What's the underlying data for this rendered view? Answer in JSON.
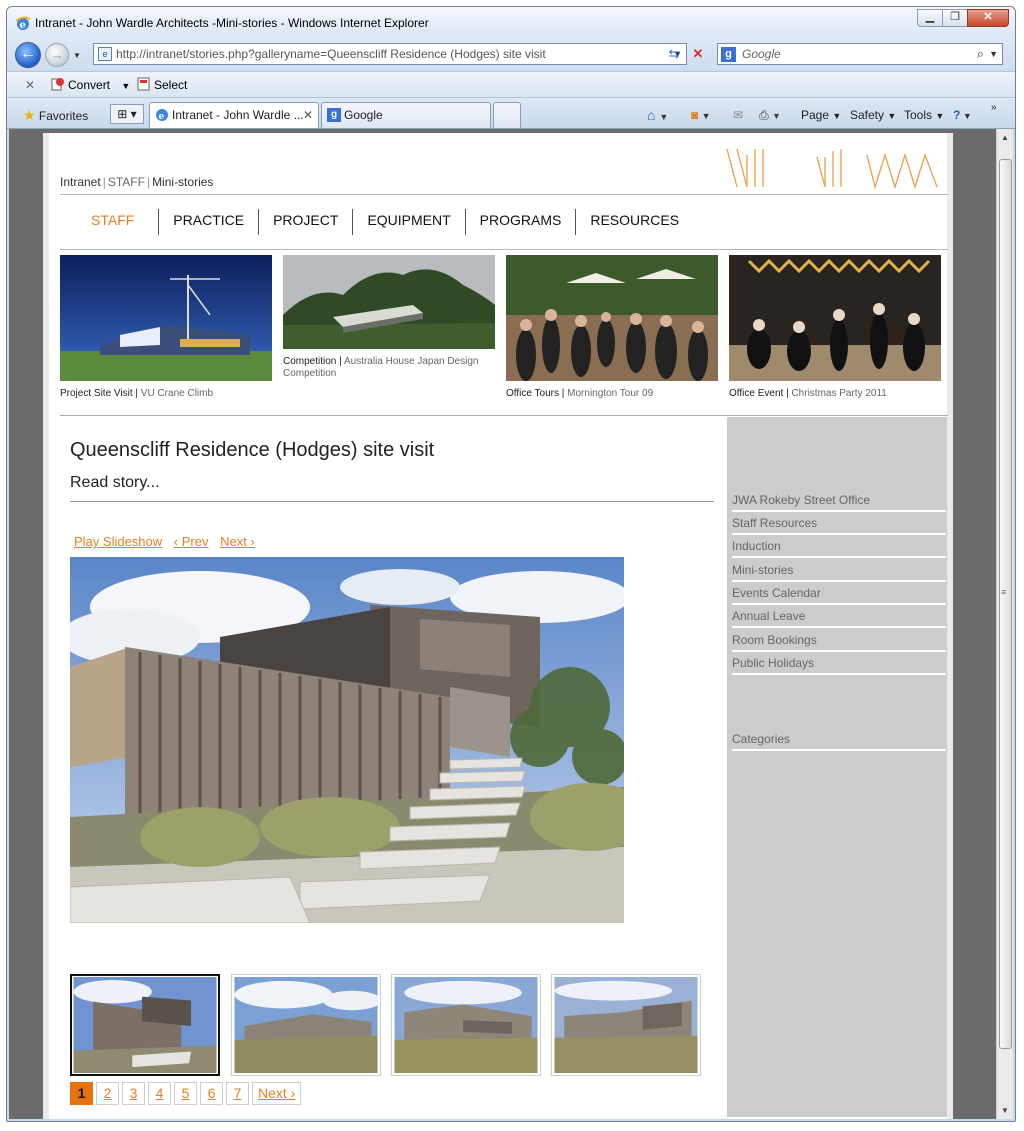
{
  "window": {
    "title": "Intranet - John Wardle Architects -Mini-stories - Windows Internet Explorer",
    "minimize": "0",
    "restore": "1",
    "close": "r"
  },
  "nav": {
    "address": "http://intranet/stories.php?galleryname=Queenscliff Residence (Hodges) site visit",
    "search_placeholder": "Google"
  },
  "commands": {
    "convert": "Convert",
    "select": "Select"
  },
  "tabs": {
    "favorites": "Favorites",
    "active_tab": "Intranet - John Wardle ...",
    "second_tab": "Google",
    "page_menu": "Page",
    "safety_menu": "Safety",
    "tools_menu": "Tools"
  },
  "site": {
    "breadcrumb": [
      "Intranet",
      "STAFF",
      "Mini-stories"
    ],
    "menu": [
      "STAFF",
      "PRACTICE",
      "PROJECT",
      "EQUIPMENT",
      "PROGRAMS",
      "RESOURCES"
    ],
    "features": [
      {
        "title": "Project Site Visit",
        "sub": "VU Crane Climb"
      },
      {
        "title": "Competition",
        "sub": "Australia House Japan Design Competition"
      },
      {
        "title": "Office Tours",
        "sub": "Mornington Tour 09"
      },
      {
        "title": "Office Event",
        "sub": "Christmas Party 2011"
      }
    ],
    "sidebar": {
      "links": [
        "JWA Rokeby Street Office",
        "Staff Resources",
        "Induction",
        "Mini-stories",
        "Events Calendar",
        "Annual Leave",
        "Room Bookings",
        "Public Holidays"
      ],
      "categories": "Categories"
    },
    "story": {
      "title": "Queenscliff Residence (Hodges) site visit",
      "read": "Read story..."
    },
    "slideshow": {
      "play": "Play Slideshow",
      "prev": "‹ Prev",
      "next": "Next ›"
    },
    "pager": {
      "pages": [
        "1",
        "2",
        "3",
        "4",
        "5",
        "6",
        "7"
      ],
      "next": "Next ›",
      "current": "1"
    }
  },
  "colors": {
    "accent": "#e67e22",
    "sidebar": "#cccccc"
  }
}
